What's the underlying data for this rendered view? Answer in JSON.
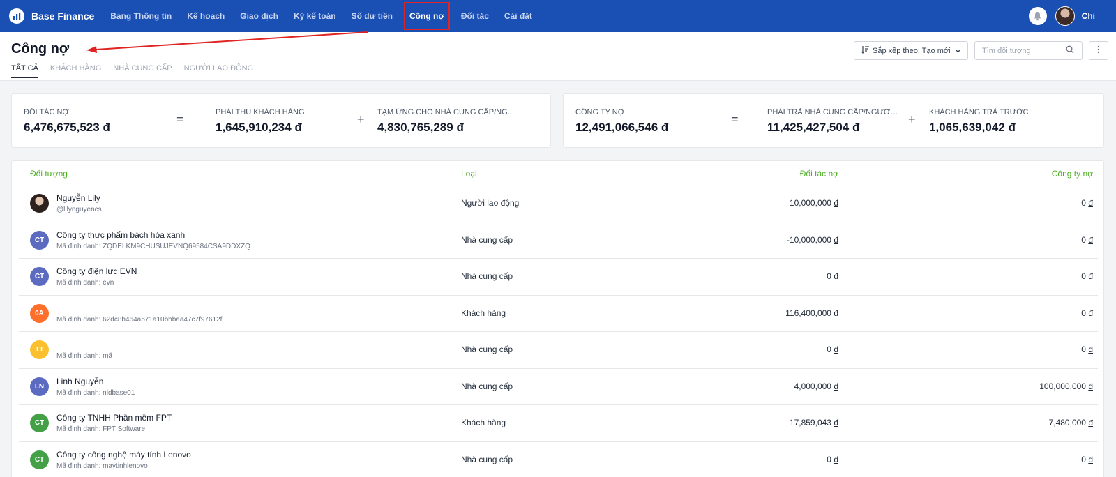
{
  "app": {
    "name": "Base Finance",
    "user_name": "Chi"
  },
  "nav": [
    {
      "label": "Bảng Thông tin"
    },
    {
      "label": "Kế hoạch"
    },
    {
      "label": "Giao dịch"
    },
    {
      "label": "Kỳ kế toán"
    },
    {
      "label": "Số dư tiền"
    },
    {
      "label": "Công nợ"
    },
    {
      "label": "Đối tác"
    },
    {
      "label": "Cài đặt"
    }
  ],
  "page": {
    "title": "Công nợ",
    "tabs": [
      {
        "label": "TẤT CẢ"
      },
      {
        "label": "KHÁCH HÀNG"
      },
      {
        "label": "NHÀ CUNG CẤP"
      },
      {
        "label": "NGƯỜI LAO ĐỘNG"
      }
    ],
    "sort_label": "Sắp xếp theo: Tạo mới",
    "search_placeholder": "Tìm đối tượng"
  },
  "summary": {
    "left": {
      "m1": {
        "label": "ĐỐI TÁC NỢ",
        "value": "6,476,675,523",
        "currency": "đ"
      },
      "op1": "=",
      "m2": {
        "label": "PHẢI THU KHÁCH HÀNG",
        "value": "1,645,910,234",
        "currency": "đ"
      },
      "op2": "+",
      "m3": {
        "label": "TẠM ỨNG CHO NHÀ CUNG CẤP/NG...",
        "value": "4,830,765,289",
        "currency": "đ"
      }
    },
    "right": {
      "m1": {
        "label": "CÔNG TY NỢ",
        "value": "12,491,066,546",
        "currency": "đ"
      },
      "op1": "=",
      "m2": {
        "label": "PHẢI TRẢ NHÀ CUNG CẤP/NGƯỜI L...",
        "value": "11,425,427,504",
        "currency": "đ"
      },
      "op2": "+",
      "m3": {
        "label": "KHÁCH HÀNG TRẢ TRƯỚC",
        "value": "1,065,639,042",
        "currency": "đ"
      }
    }
  },
  "table": {
    "headers": {
      "object": "Đối tượng",
      "type": "Loại",
      "partner_debt": "Đối tác nợ",
      "company_debt": "Công ty nợ"
    },
    "rows": [
      {
        "initials": "",
        "avatar_color": "",
        "name": "Nguyễn Lily",
        "sub": "@lilynguyencs",
        "type": "Người lao động",
        "partner_debt": "10,000,000",
        "company_debt": "0",
        "currency": "đ"
      },
      {
        "initials": "CT",
        "avatar_color": "#5c6bc0",
        "name": "Công ty thực phẩm bách hóa xanh",
        "sub": "Mã định danh: ZQDELKM9CHUSUJEVNQ69584CSA9DDXZQ",
        "type": "Nhà cung cấp",
        "partner_debt": "-10,000,000",
        "company_debt": "0",
        "currency": "đ"
      },
      {
        "initials": "CT",
        "avatar_color": "#5c6bc0",
        "name": "Công ty điện lực EVN",
        "sub": "Mã định danh: evn",
        "type": "Nhà cung cấp",
        "partner_debt": "0",
        "company_debt": "0",
        "currency": "đ"
      },
      {
        "initials": "0A",
        "avatar_color": "#ff6f2c",
        "name": "",
        "sub": "Mã định danh: 62dc8b464a571a10bbbaa47c7f97612f",
        "type": "Khách hàng",
        "partner_debt": "116,400,000",
        "company_debt": "0",
        "currency": "đ"
      },
      {
        "initials": "TT",
        "avatar_color": "#fbc02d",
        "name": "",
        "sub": "Mã định danh: mã",
        "type": "Nhà cung cấp",
        "partner_debt": "0",
        "company_debt": "0",
        "currency": "đ"
      },
      {
        "initials": "LN",
        "avatar_color": "#5c6bc0",
        "name": "Linh Nguyễn",
        "sub": "Mã định danh: nldbase01",
        "type": "Nhà cung cấp",
        "partner_debt": "4,000,000",
        "company_debt": "100,000,000",
        "currency": "đ"
      },
      {
        "initials": "CT",
        "avatar_color": "#43a047",
        "name": "Công ty TNHH Phần mềm FPT",
        "sub": "Mã định danh: FPT Software",
        "type": "Khách hàng",
        "partner_debt": "17,859,043",
        "company_debt": "7,480,000",
        "currency": "đ"
      },
      {
        "initials": "CT",
        "avatar_color": "#43a047",
        "name": "Công ty công nghệ máy tính Lenovo",
        "sub": "Mã định danh: maytinhlenovo",
        "type": "Nhà cung cấp",
        "partner_debt": "0",
        "company_debt": "0",
        "currency": "đ"
      }
    ]
  },
  "colors": {
    "topbar": "#1a4fb4",
    "header_green": "#4caf22",
    "highlight_red": "#e02424"
  },
  "icons": {
    "logo": "bar-chart-icon",
    "bell": "bell-icon",
    "sort": "sort-icon",
    "search": "search-icon",
    "more": "more-vertical-icon"
  }
}
